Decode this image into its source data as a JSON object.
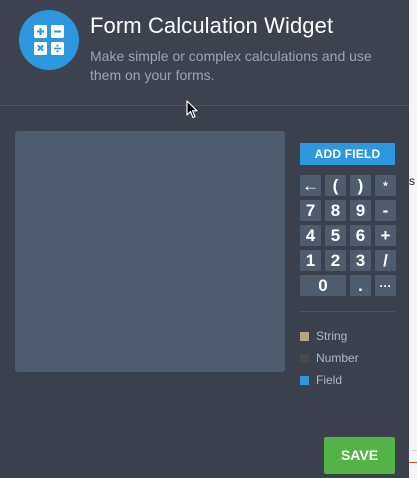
{
  "header": {
    "title": "Form Calculation Widget",
    "subtitle": "Make simple or complex calculations and use them on your forms.",
    "logo_icon": "calculator-icon"
  },
  "editor": {
    "add_field_label": "ADD FIELD",
    "keypad": [
      {
        "label": "←",
        "name": "backspace"
      },
      {
        "label": "(",
        "name": "open-paren"
      },
      {
        "label": ")",
        "name": "close-paren"
      },
      {
        "label": "*",
        "name": "multiply"
      },
      {
        "label": "7",
        "name": "7"
      },
      {
        "label": "8",
        "name": "8"
      },
      {
        "label": "9",
        "name": "9"
      },
      {
        "label": "-",
        "name": "minus"
      },
      {
        "label": "4",
        "name": "4"
      },
      {
        "label": "5",
        "name": "5"
      },
      {
        "label": "6",
        "name": "6"
      },
      {
        "label": "+",
        "name": "plus"
      },
      {
        "label": "1",
        "name": "1"
      },
      {
        "label": "2",
        "name": "2"
      },
      {
        "label": "3",
        "name": "3"
      },
      {
        "label": "/",
        "name": "divide"
      },
      {
        "label": "0",
        "name": "0"
      },
      {
        "label": ".",
        "name": "decimal"
      },
      {
        "label": "···",
        "name": "more"
      }
    ]
  },
  "legend": [
    {
      "label": "String",
      "color": "#b8a487"
    },
    {
      "label": "Number",
      "color": "#4a4a4a"
    },
    {
      "label": "Field",
      "color": "#2e98de"
    }
  ],
  "footer": {
    "save_label": "SAVE"
  },
  "background_page": {
    "fragment_text": "s"
  },
  "colors": {
    "accent": "#2e98de",
    "save": "#52b444",
    "panel": "#3a414c",
    "formula_bg": "#4f5c6e"
  }
}
